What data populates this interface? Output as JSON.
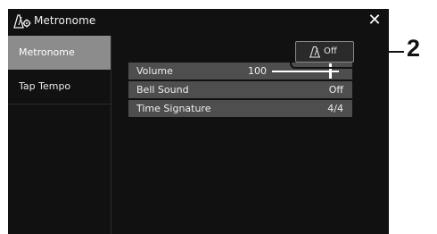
{
  "window": {
    "title": "Metronome",
    "title_icon": "metronome-gear-icon",
    "close_label": "✕"
  },
  "sidebar": {
    "items": [
      {
        "label": "Metronome",
        "active": true
      },
      {
        "label": "Tap Tempo",
        "active": false
      }
    ]
  },
  "toggle": {
    "icon": "metronome-icon",
    "label": "Off"
  },
  "settings": [
    {
      "name": "Volume",
      "value": "100",
      "level": 100
    },
    {
      "name": "Bell Sound",
      "value": "Off"
    },
    {
      "name": "Time Signature",
      "value": "4/4"
    }
  ],
  "callout": {
    "number": "2"
  },
  "colors": {
    "screen_bg": "#111111",
    "active_tab": "#8c8c8c",
    "row_bg": "#4e4e4e",
    "text": "#f0f0f0"
  }
}
